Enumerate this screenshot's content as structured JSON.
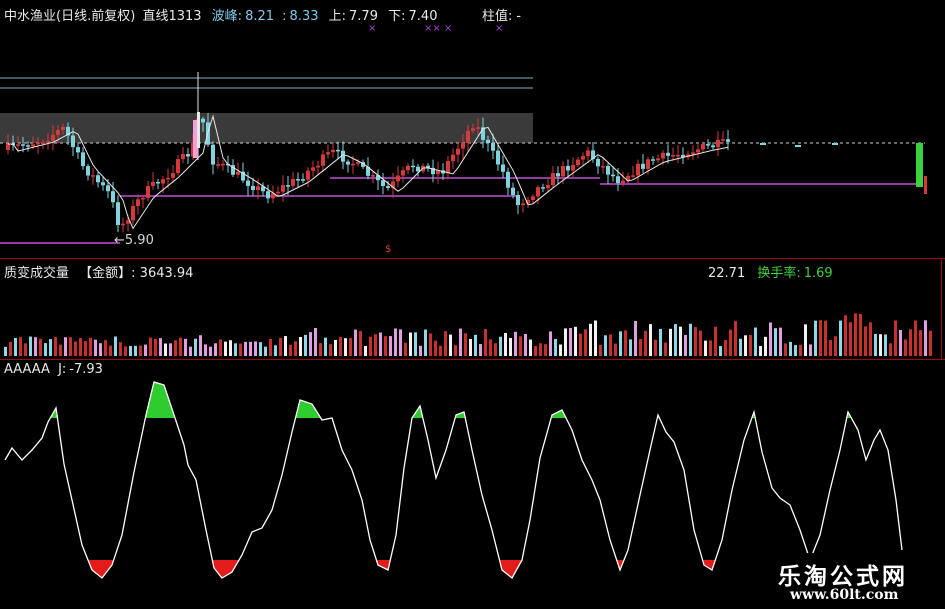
{
  "stock": {
    "name": "中水渔业",
    "mode": "(日线.前复权)",
    "extra": "直线1313",
    "wave_label": "波峰:",
    "wave_a": "8.21",
    "wave_sep": ":",
    "wave_b": "8.33",
    "up_label": "上:",
    "up_value": "7.79",
    "down_label": "下:",
    "down_value": "7.40",
    "col_label": "柱值:",
    "col_value": "-",
    "low_marker": "5.90"
  },
  "volume_panel": {
    "name": "质变成交量",
    "amount_label": "【金额】",
    "amount_value": ": 3643.94",
    "hidden_fragment": "22.71",
    "turnover_label": "换手率:",
    "turnover_value": "1.69"
  },
  "indicator_panel": {
    "name": "AAAAA",
    "j_label": "J:",
    "j_value": "-7.93"
  },
  "watermark": {
    "title": "乐淘公式网",
    "url": "www.60lt.com"
  },
  "colors": {
    "background": "#000000",
    "up_candle": "#d43a3a",
    "down_candle": "#7fd4e0",
    "ma_line": "#e8e8e8",
    "support_line": "#c050d8",
    "panel_border": "#9a1010",
    "j_line": "#ffffff",
    "j_high": "#2ecc2e",
    "j_low": "#e41b1b",
    "volume_highlight": "#f0e24a"
  }
}
